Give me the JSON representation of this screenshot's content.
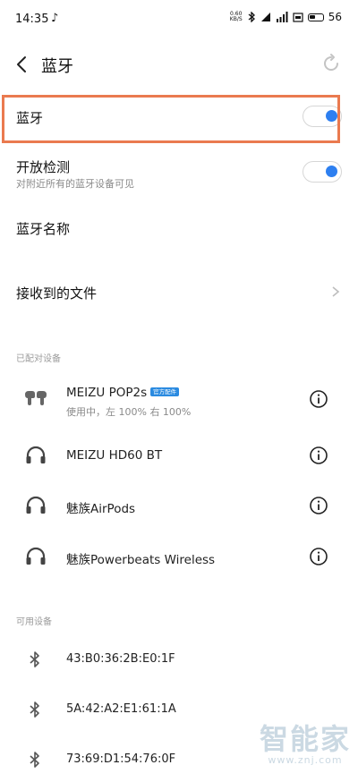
{
  "status_bar": {
    "time": "14:35",
    "music_note": "♪",
    "net_speed_value": "0.60",
    "net_speed_unit": "KB/S",
    "battery_level": "56"
  },
  "header": {
    "title": "蓝牙"
  },
  "settings": {
    "bluetooth_label": "蓝牙",
    "bluetooth_enabled": true,
    "discoverable_label": "开放检测",
    "discoverable_sub": "对附近所有的蓝牙设备可见",
    "discoverable_enabled": true,
    "name_label": "蓝牙名称",
    "received_files_label": "接收到的文件"
  },
  "paired": {
    "section_title": "已配对设备",
    "devices": [
      {
        "name": "MEIZU POP2s",
        "badge": "官方配件",
        "status": "使用中，左 100%  右 100%",
        "icon": "earbuds-icon"
      },
      {
        "name": "MEIZU HD60 BT",
        "icon": "headphones-icon"
      },
      {
        "name": "魅族AirPods",
        "icon": "headphones-icon"
      },
      {
        "name": "魅族Powerbeats Wireless",
        "icon": "headphones-icon"
      }
    ]
  },
  "available": {
    "section_title": "可用设备",
    "devices": [
      {
        "address": "43:B0:36:2B:E0:1F"
      },
      {
        "address": "5A:42:A2:E1:61:1A"
      },
      {
        "address": "73:69:D1:54:76:0F"
      }
    ]
  },
  "watermark": {
    "text": "智能家",
    "url": "www.znj.com"
  },
  "colors": {
    "accent": "#2d7ff0",
    "highlight": "#ea7a4f"
  }
}
